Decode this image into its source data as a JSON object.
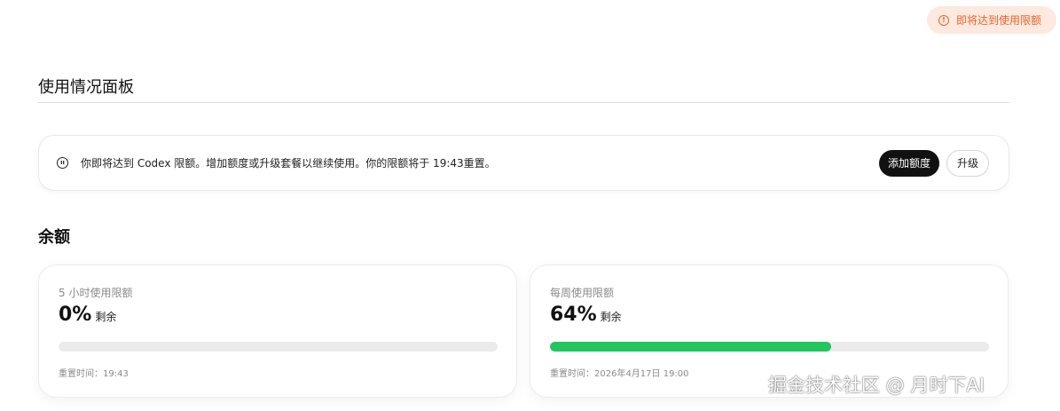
{
  "toast": {
    "icon": "alert-circle-icon",
    "text": "即将达到使用限额"
  },
  "page": {
    "title": "使用情况面板"
  },
  "banner": {
    "icon": "clock-icon",
    "message": "你即将达到 Codex 限额。增加额度或升级套餐以继续使用。你的限额将于 19:43重置。",
    "add_credits_label": "添加额度",
    "upgrade_label": "升级"
  },
  "balance": {
    "title": "余额",
    "cards": [
      {
        "label": "5 小时使用限额",
        "value": "0%",
        "suffix": "剩余",
        "progress": 0,
        "reset": "重置时间：19:43"
      },
      {
        "label": "每周使用限额",
        "value": "64%",
        "suffix": "剩余",
        "progress": 0.64,
        "reset": "重置时间：2026年4月17日 19:00"
      }
    ]
  },
  "watermark": "掘金技术社区 @ 月时下AI",
  "colors": {
    "toast_bg": "#fde9df",
    "toast_text": "#e2672d",
    "primary_button": "#111111",
    "progress_fill": "#22c55e",
    "progress_track": "#ebebeb"
  }
}
